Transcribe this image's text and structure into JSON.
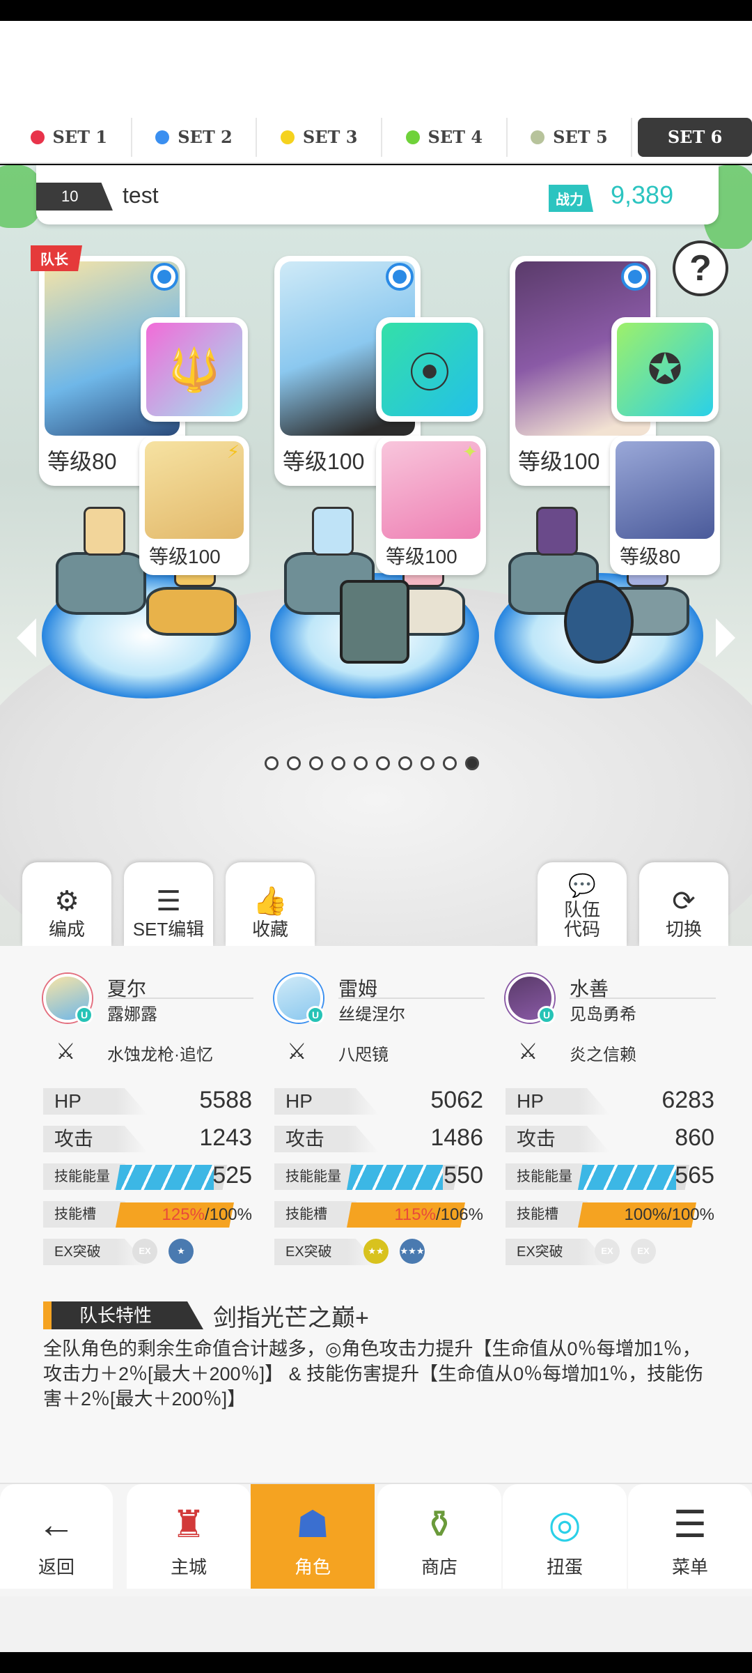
{
  "set_tabs": [
    {
      "label": "SET 1",
      "color": "#e8334a"
    },
    {
      "label": "SET 2",
      "color": "#3a8ff0"
    },
    {
      "label": "SET 3",
      "color": "#f5d21e"
    },
    {
      "label": "SET 4",
      "color": "#6fd23a"
    },
    {
      "label": "SET 5",
      "color": "#b7c39b"
    },
    {
      "label": "SET 6",
      "color": "#3a3a3a"
    }
  ],
  "team": {
    "number": "10",
    "name": "test",
    "power_label": "战力",
    "power_value": "9,389"
  },
  "leader_tag": "队长",
  "help_label": "?",
  "characters": [
    {
      "level": "等级80",
      "sub_level": "等级100",
      "weapon_icon": "trident-icon",
      "sub_mark": "⚡"
    },
    {
      "level": "等级100",
      "sub_level": "等级100",
      "weapon_icon": "mirror-icon",
      "sub_mark": "✦"
    },
    {
      "level": "等级100",
      "sub_level": "等级80",
      "weapon_icon": "emblem-icon",
      "sub_mark": ""
    }
  ],
  "scene_buttons": {
    "formation": "编成",
    "set_edit": "SET编辑",
    "favorite": "收藏",
    "team_code_line1": "队伍",
    "team_code_line2": "代码",
    "switch": "切换"
  },
  "stats": [
    {
      "name": "夏尔",
      "partner": "露娜露",
      "weapon": "水蚀龙枪·追忆",
      "hp": "5588",
      "attack": "1243",
      "skill_energy": "525",
      "skill_energy_fill": 0.88,
      "slot_current": "125",
      "slot_max": "/100",
      "slot_fill": 1.0,
      "ex_badges": [
        "EX",
        "★"
      ]
    },
    {
      "name": "雷姆",
      "partner": "丝缇涅尔",
      "weapon": "八咫镜",
      "hp": "5062",
      "attack": "1486",
      "skill_energy": "550",
      "skill_energy_fill": 0.86,
      "slot_current": "115",
      "slot_max": "/106",
      "slot_fill": 1.0,
      "ex_badges": [
        "★★",
        "★★★"
      ]
    },
    {
      "name": "水善",
      "partner": "见岛勇希",
      "weapon": "炎之信赖",
      "hp": "6283",
      "attack": "860",
      "skill_energy": "565",
      "skill_energy_fill": 0.88,
      "slot_current": "100",
      "slot_max": "/100",
      "slot_fill": 1.0,
      "ex_badges": [
        "EX",
        "EX"
      ]
    }
  ],
  "stat_labels": {
    "hp": "HP",
    "attack": "攻击",
    "skill_energy": "技能能量",
    "skill_slot": "技能槽",
    "ex": "EX突破",
    "percent": "%"
  },
  "leader_skill": {
    "label": "队长特性",
    "name": "剑指光芒之巅+",
    "description": "全队角色的剩余生命值合计越多，◎角色攻击力提升【生命值从0％每增加1％，攻击力＋2％[最大＋200％]】 & 技能伤害提升【生命值从0％每增加1％，技能伤害＋2％[最大＋200％]】"
  },
  "bottom_nav": [
    {
      "label": "返回",
      "icon": "back-arrow-icon",
      "glyph": "←"
    },
    {
      "label": "主城",
      "icon": "castle-icon",
      "glyph": "♜"
    },
    {
      "label": "角色",
      "icon": "character-icon",
      "glyph": "☗"
    },
    {
      "label": "商店",
      "icon": "shop-icon",
      "glyph": "⚱"
    },
    {
      "label": "扭蛋",
      "icon": "gacha-icon",
      "glyph": "◎"
    },
    {
      "label": "菜单",
      "icon": "menu-icon",
      "glyph": "☰"
    }
  ],
  "colors": {
    "accent_orange": "#f5a321",
    "power_teal": "#2cc4c0",
    "leader_red": "#e53a3a",
    "badge_blue": "#2a8ae5"
  }
}
